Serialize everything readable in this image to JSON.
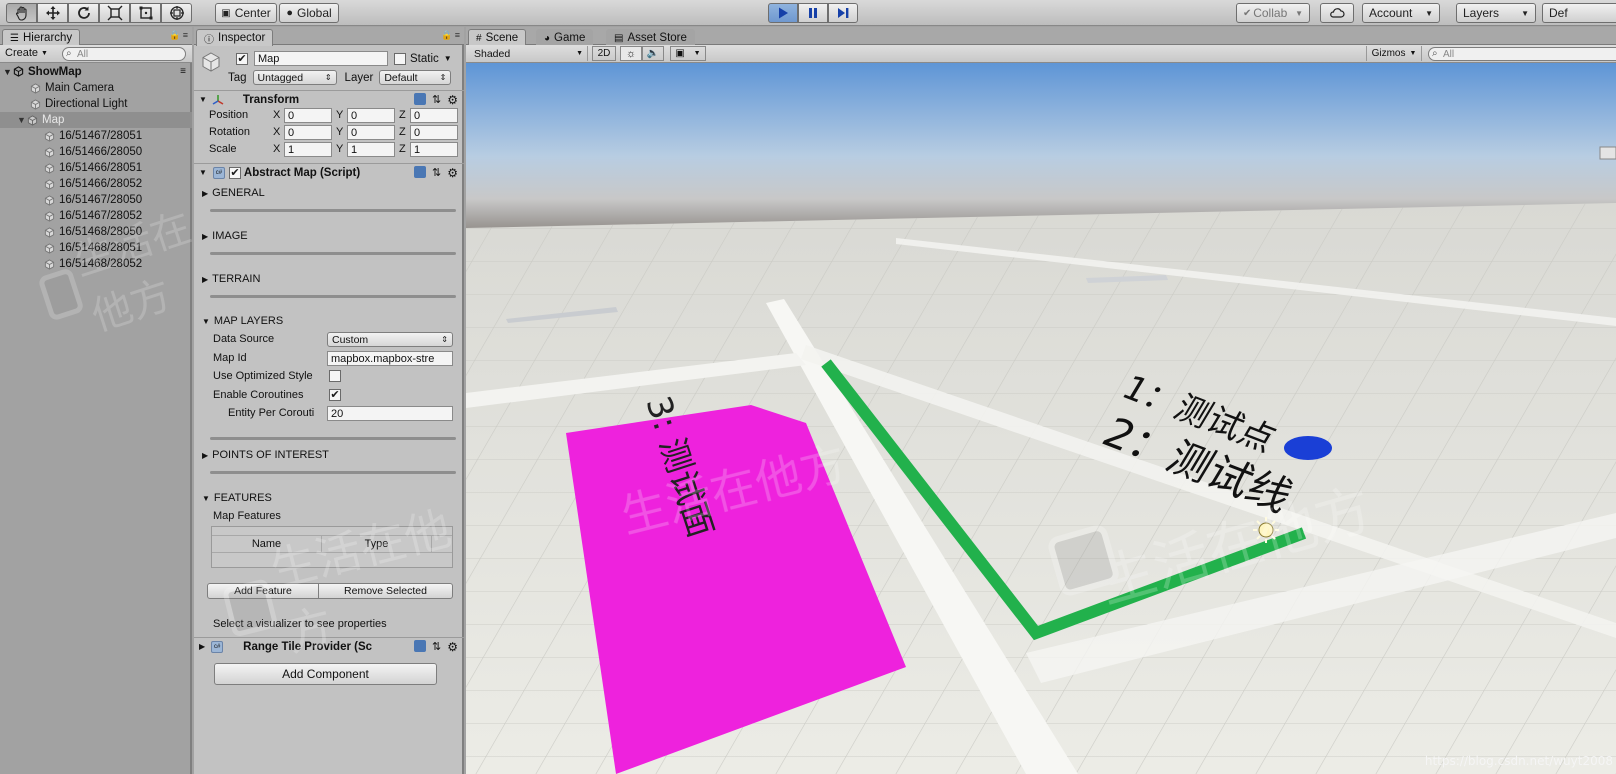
{
  "toolbar": {
    "tools": [
      "hand-tool",
      "move-tool",
      "rotate-tool",
      "scale-tool",
      "rect-tool",
      "transform-tool"
    ],
    "pivot_label": "Center",
    "space_label": "Global",
    "collab_label": "Collab",
    "account_label": "Account",
    "layers_label": "Layers",
    "layout_label": "Def"
  },
  "hierarchy": {
    "tab_label": "Hierarchy",
    "create_label": "Create",
    "search_placeholder": "All",
    "scene_name": "ShowMap",
    "items": [
      {
        "label": "Main Camera"
      },
      {
        "label": "Directional Light"
      },
      {
        "label": "Map"
      },
      {
        "label": "16/51467/28051"
      },
      {
        "label": "16/51466/28050"
      },
      {
        "label": "16/51466/28051"
      },
      {
        "label": "16/51466/28052"
      },
      {
        "label": "16/51467/28050"
      },
      {
        "label": "16/51467/28052"
      },
      {
        "label": "16/51468/28050"
      },
      {
        "label": "16/51468/28051"
      },
      {
        "label": "16/51468/28052"
      }
    ]
  },
  "inspector": {
    "tab_label": "Inspector",
    "object_name": "Map",
    "static_label": "Static",
    "tag_label": "Tag",
    "tag_value": "Untagged",
    "layer_label": "Layer",
    "layer_value": "Default",
    "transform": {
      "title": "Transform",
      "position_label": "Position",
      "rotation_label": "Rotation",
      "scale_label": "Scale",
      "axis_x": "X",
      "axis_y": "Y",
      "axis_z": "Z",
      "position": [
        "0",
        "0",
        "0"
      ],
      "rotation": [
        "0",
        "0",
        "0"
      ],
      "scale": [
        "1",
        "1",
        "1"
      ]
    },
    "abstract_map": {
      "title": "Abstract Map (Script)",
      "general": "GENERAL",
      "image": "IMAGE",
      "terrain": "TERRAIN",
      "map_layers": "MAP LAYERS",
      "data_source_label": "Data Source",
      "data_source_value": "Custom",
      "map_id_label": "Map Id",
      "map_id_value": "mapbox.mapbox-stre",
      "optimized_label": "Use Optimized Style",
      "coroutines_label": "Enable Coroutines",
      "entity_label": "Entity Per Corouti",
      "entity_value": "20",
      "poi": "POINTS OF INTEREST",
      "features": "FEATURES",
      "map_features_label": "Map Features",
      "col_name": "Name",
      "col_type": "Type",
      "add_feature": "Add Feature",
      "remove_selected": "Remove Selected",
      "select_hint": "Select a visualizer to see properties"
    },
    "range_tile": {
      "title": "Range Tile Provider (Sc"
    },
    "add_component": "Add Component"
  },
  "scene": {
    "tabs": [
      "Scene",
      "Game",
      "Asset Store"
    ],
    "shading_label": "Shaded",
    "mode_2d": "2D",
    "gizmos_label": "Gizmos",
    "search_placeholder": "All",
    "labels": {
      "polygon": "3: 测试面",
      "point": "1：测试点",
      "line": "2：测试线"
    },
    "watermark": "生活在他方",
    "credit": "https://blog.csdn.net/wuyt2008"
  },
  "colors": {
    "polygon": "#ee22dd",
    "line": "#22b14c",
    "point": "#1a3fd6",
    "sky_top": "#5e95d6",
    "ground": "#e9e9e2",
    "play_active": "#7ea4d6"
  }
}
